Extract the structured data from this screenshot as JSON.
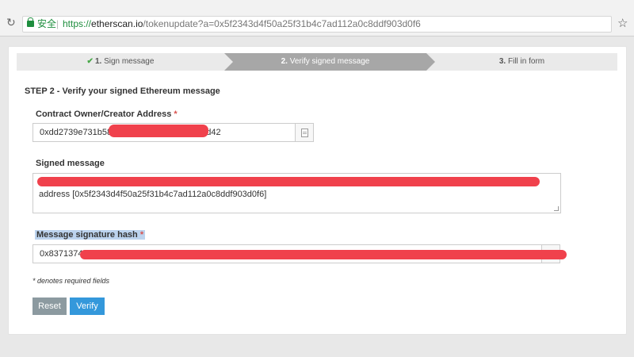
{
  "browser": {
    "security_label": "安全",
    "url_scheme": "https://",
    "url_host": "etherscan.io",
    "url_path": "/tokenupdate?a=0x5f2343d4f50a25f31b4c7ad112a0c8ddf903d0f6",
    "icons": [
      "reload-icon",
      "lock-icon",
      "star-icon"
    ]
  },
  "wizard": {
    "step1_num": "1.",
    "step1_label": "Sign message",
    "step2_num": "2.",
    "step2_label": "Verify signed message",
    "step3_num": "3.",
    "step3_label": "Fill in form"
  },
  "form": {
    "heading": "STEP 2 - Verify your signed Ethereum message",
    "owner_label": "Contract Owner/Creator Address",
    "owner_value_start": "0xdd2739e731b584",
    "owner_value_end": "d42",
    "signed_label": "Signed message",
    "signed_value_line2": "address [0x5f2343d4f50a25f31b4c7ad112a0c8ddf903d0f6]",
    "hash_label": "Message signature hash",
    "hash_value_start": "0x8371374c",
    "required_mark": "*",
    "note": "* denotes required fields",
    "reset_label": "Reset",
    "verify_label": "Verify"
  }
}
